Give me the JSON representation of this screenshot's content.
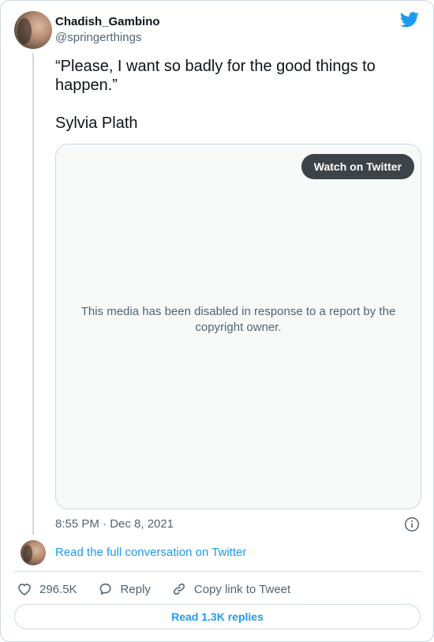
{
  "author": {
    "display_name": "Chadish_Gambino",
    "handle": "@springerthings"
  },
  "tweet": {
    "text_line1": "“Please, I want so badly for the good things to happen.”",
    "text_line2": "Sylvia Plath"
  },
  "media": {
    "watch_label": "Watch on Twitter",
    "disabled_message": "This media has been disabled in response to a report by the copyright owner."
  },
  "timestamp": "8:55 PM · Dec 8, 2021",
  "conversation": {
    "read_full_label": "Read the full conversation on Twitter"
  },
  "actions": {
    "likes_count": "296.5K",
    "reply_label": "Reply",
    "copy_link_label": "Copy link to Tweet"
  },
  "replies_button_label": "Read 1.3K replies",
  "colors": {
    "accent": "#1d9bf0",
    "muted_text": "#536471",
    "border": "#cfd9de",
    "watch_button_bg": "#3e4347"
  },
  "icons": {
    "logo": "twitter-bird-icon",
    "info": "info-icon",
    "like": "heart-icon",
    "reply": "reply-bubble-icon",
    "copy_link": "link-icon"
  }
}
